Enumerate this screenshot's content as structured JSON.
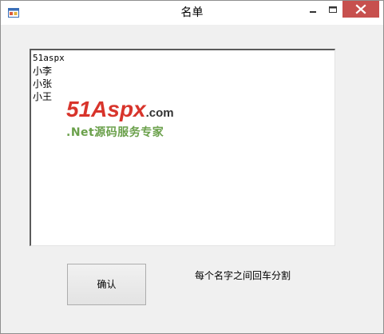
{
  "window": {
    "title": "名单"
  },
  "textarea": {
    "lines": [
      "51aspx",
      "小李",
      "小张",
      "小王"
    ]
  },
  "watermark": {
    "main": "51Aspx",
    "suffix": ".com",
    "sub": ".Net源码服务专家",
    "colors": {
      "main": "#d8342b",
      "sub": "#6aa04a"
    }
  },
  "buttons": {
    "confirm_label": "确认"
  },
  "hint": "每个名字之间回车分割",
  "colors": {
    "close_button": "#c7504e",
    "client_background": "#f0f0f0"
  }
}
